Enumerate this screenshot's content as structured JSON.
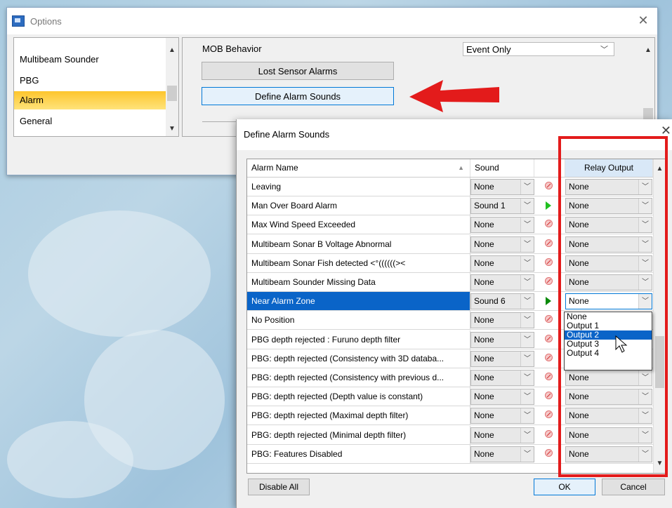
{
  "options_window": {
    "title": "Options",
    "nav_items": [
      {
        "label": "Multibeam Sounder",
        "selected": false
      },
      {
        "label": "PBG",
        "selected": false
      },
      {
        "label": "Alarm",
        "selected": true
      },
      {
        "label": "General",
        "selected": false
      }
    ],
    "mob_behavior_label": "MOB Behavior",
    "mob_behavior_value": "Event Only",
    "lost_sensor_button": "Lost Sensor Alarms",
    "define_sounds_button": "Define Alarm Sounds"
  },
  "dialog": {
    "title": "Define Alarm Sounds",
    "columns": {
      "name": "Alarm Name",
      "sound": "Sound",
      "relay": "Relay Output"
    },
    "rows": [
      {
        "name": "Leaving",
        "sound": "None",
        "icon": "mute",
        "relay": "None"
      },
      {
        "name": "Man Over Board Alarm",
        "sound": "Sound 1",
        "icon": "play",
        "relay": "None"
      },
      {
        "name": "Max Wind Speed Exceeded",
        "sound": "None",
        "icon": "mute",
        "relay": "None"
      },
      {
        "name": "Multibeam Sonar B Voltage Abnormal",
        "sound": "None",
        "icon": "mute",
        "relay": "None"
      },
      {
        "name": "Multibeam Sonar Fish detected <°((((((><",
        "sound": "None",
        "icon": "mute",
        "relay": "None"
      },
      {
        "name": "Multibeam Sounder Missing Data",
        "sound": "None",
        "icon": "mute",
        "relay": "None"
      },
      {
        "name": "Near Alarm Zone",
        "sound": "Sound 6",
        "icon": "play",
        "relay": "None",
        "selected": true
      },
      {
        "name": "No Position",
        "sound": "None",
        "icon": "mute",
        "relay": ""
      },
      {
        "name": "PBG depth rejected : Furuno depth filter",
        "sound": "None",
        "icon": "mute",
        "relay": ""
      },
      {
        "name": "PBG: depth rejected (Consistency with 3D databa...",
        "sound": "None",
        "icon": "mute",
        "relay": ""
      },
      {
        "name": "PBG: depth rejected (Consistency with previous d...",
        "sound": "None",
        "icon": "mute",
        "relay": "None"
      },
      {
        "name": "PBG: depth rejected (Depth value is constant)",
        "sound": "None",
        "icon": "mute",
        "relay": "None"
      },
      {
        "name": "PBG: depth rejected (Maximal depth filter)",
        "sound": "None",
        "icon": "mute",
        "relay": "None"
      },
      {
        "name": "PBG: depth rejected (Minimal depth filter)",
        "sound": "None",
        "icon": "mute",
        "relay": "None"
      },
      {
        "name": "PBG: Features Disabled",
        "sound": "None",
        "icon": "mute",
        "relay": "None"
      }
    ],
    "relay_options": [
      "None",
      "Output 1",
      "Output 2",
      "Output 3",
      "Output 4"
    ],
    "relay_highlighted": "Output 2",
    "disable_all_button": "Disable All",
    "ok_button": "OK",
    "cancel_button": "Cancel"
  },
  "colors": {
    "selection_blue": "#0a64c8",
    "annotation_red": "#e31b1b",
    "nav_selected": "#fdc52d"
  }
}
